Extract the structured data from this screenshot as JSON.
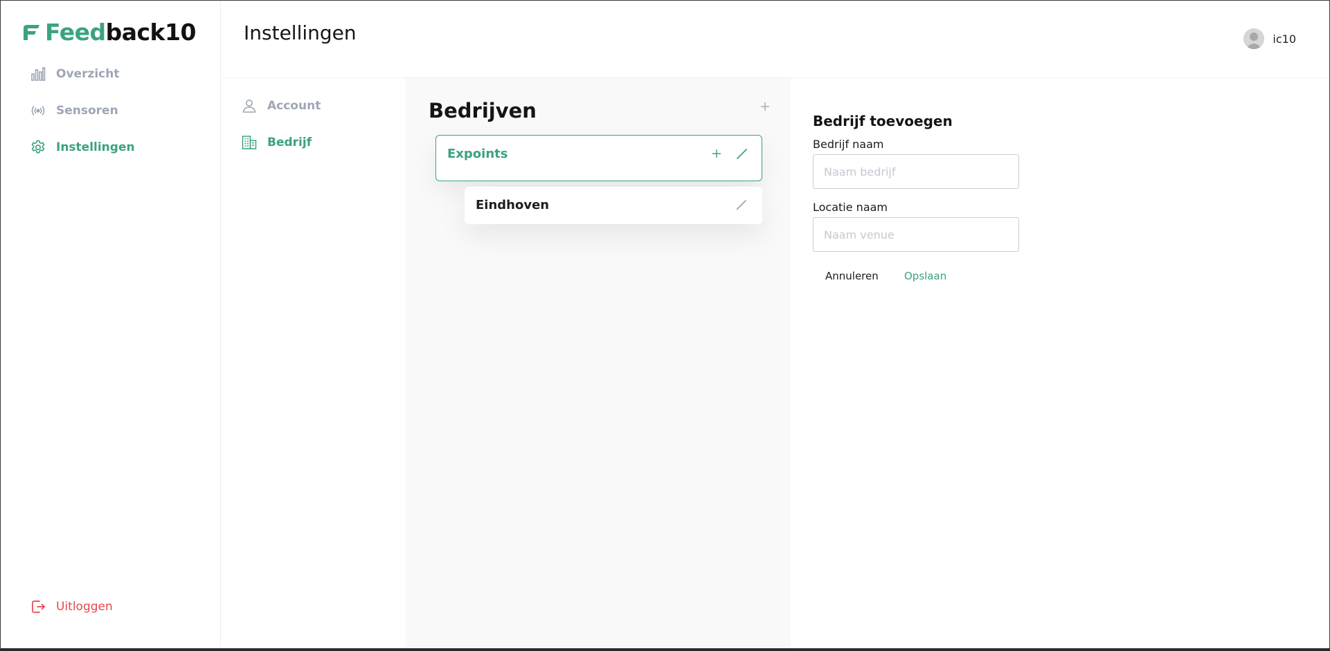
{
  "brand": {
    "name_part1": "Feed",
    "name_part2": "back10",
    "accent": "#3aa37d"
  },
  "sidebar": {
    "items": [
      {
        "label": "Overzicht",
        "icon": "bar-chart-icon",
        "active": false
      },
      {
        "label": "Sensoren",
        "icon": "broadcast-icon",
        "active": false
      },
      {
        "label": "Instellingen",
        "icon": "gear-icon",
        "active": true
      }
    ],
    "logout_label": "Uitloggen",
    "logout_color": "#e5484d"
  },
  "header": {
    "title": "Instellingen",
    "user_name": "ic10"
  },
  "settings_nav": {
    "items": [
      {
        "label": "Account",
        "icon": "user-icon",
        "active": false
      },
      {
        "label": "Bedrijf",
        "icon": "building-icon",
        "active": true
      }
    ]
  },
  "companies": {
    "title": "Bedrijven",
    "add_icon": "plus-icon",
    "list": [
      {
        "name": "Expoints",
        "selected": true,
        "locations": [
          {
            "name": "Eindhoven"
          }
        ]
      }
    ]
  },
  "form": {
    "title": "Bedrijf toevoegen",
    "company_label": "Bedrijf naam",
    "company_placeholder": "Naam bedrijf",
    "location_label": "Locatie naam",
    "location_placeholder": "Naam venue",
    "cancel_label": "Annuleren",
    "save_label": "Opslaan"
  }
}
